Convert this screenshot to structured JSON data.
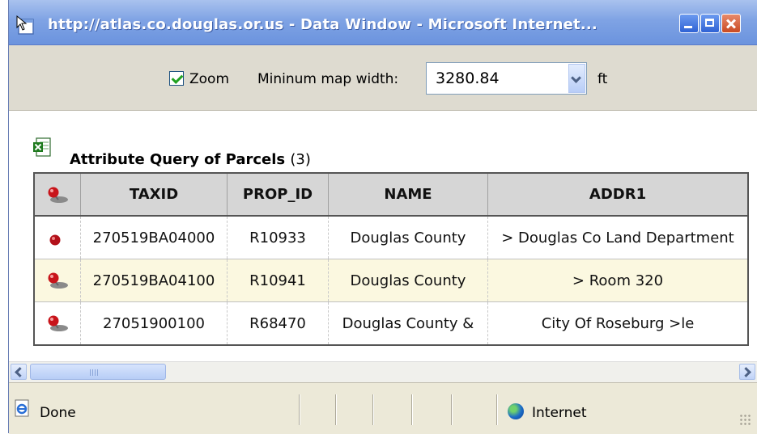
{
  "window": {
    "title": "http://atlas.co.douglas.or.us - Data Window - Microsoft Internet..."
  },
  "toolbar": {
    "zoom_checked": true,
    "zoom_label": "Zoom",
    "min_width_label": "Mininum map width:",
    "min_width_value": "3280.84",
    "unit_label": "ft"
  },
  "query": {
    "title": "Attribute Query of Parcels",
    "count": "(3)",
    "columns": [
      "TAXID",
      "PROP_ID",
      "NAME",
      "ADDR1"
    ],
    "rows": [
      {
        "icon": "red-dot-icon",
        "taxid": "270519BA04000",
        "prop_id": "R10933",
        "name": "Douglas County",
        "addr1": "> Douglas Co Land Department"
      },
      {
        "icon": "pushpin-icon",
        "taxid": "270519BA04100",
        "prop_id": "R10941",
        "name": "Douglas County",
        "addr1": "> Room 320"
      },
      {
        "icon": "pushpin-icon",
        "taxid": "27051900100",
        "prop_id": "R68470",
        "name": "Douglas County &",
        "addr1": "City Of Roseburg >le"
      }
    ]
  },
  "status": {
    "text": "Done",
    "zone": "Internet"
  },
  "colors": {
    "title_bar": "#7fa3e4",
    "header_bg": "#d6d6d6",
    "highlight_row": "#fbf8e0",
    "status_bar": "#ece9d8"
  }
}
